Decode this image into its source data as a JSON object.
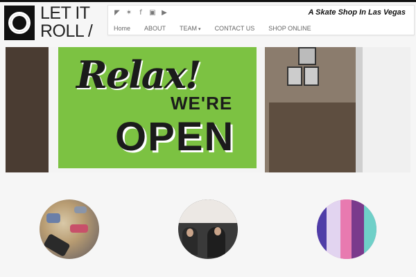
{
  "brand": {
    "logo_line1": "LET IT",
    "logo_line2": "ROLL /"
  },
  "header": {
    "tagline": "A Skate Shop In Las Vegas",
    "social": [
      {
        "icon": "rss-icon",
        "glyph": "◤"
      },
      {
        "icon": "twitter-icon",
        "glyph": "✶"
      },
      {
        "icon": "facebook-icon",
        "glyph": "f"
      },
      {
        "icon": "instagram-icon",
        "glyph": "▣"
      },
      {
        "icon": "youtube-icon",
        "glyph": "▶"
      }
    ]
  },
  "nav": {
    "items": [
      {
        "label": "Home"
      },
      {
        "label": "ABOUT"
      },
      {
        "label": "TEAM"
      },
      {
        "label": "CONTACT US"
      },
      {
        "label": "SHOP ONLINE"
      }
    ]
  },
  "hero": {
    "sign_line1": "Relax!",
    "sign_line2": "WE'RE",
    "sign_line3": "OPEN"
  },
  "colors": {
    "sign_green": "#7cc242",
    "text_dark": "#1b1b1b",
    "nav_text": "#666666"
  }
}
